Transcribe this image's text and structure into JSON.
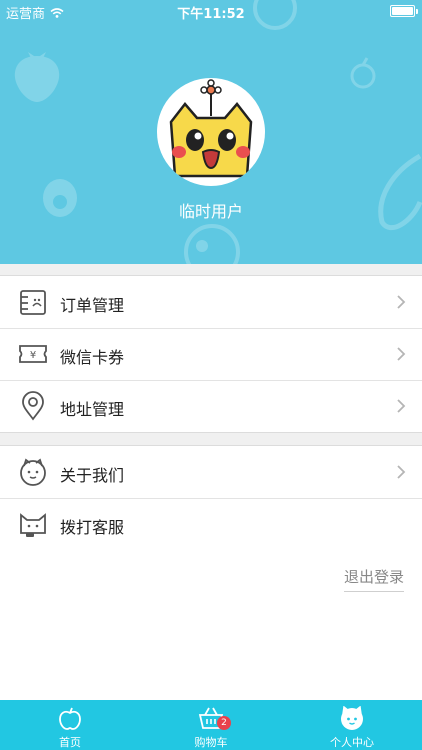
{
  "status_bar": {
    "carrier": "运营商",
    "time": "下午11:52"
  },
  "profile": {
    "username": "临时用户"
  },
  "menu_group_1": [
    {
      "label": "订单管理",
      "icon": "order-icon"
    },
    {
      "label": "微信卡券",
      "icon": "coupon-icon"
    },
    {
      "label": "地址管理",
      "icon": "location-pin-icon"
    }
  ],
  "menu_group_2": [
    {
      "label": "关于我们",
      "icon": "cat-face-icon"
    },
    {
      "label": "拨打客服",
      "icon": "cat-headset-icon"
    }
  ],
  "logout_label": "退出登录",
  "tabbar": {
    "tabs": [
      {
        "label": "首页",
        "icon": "apple-icon"
      },
      {
        "label": "购物车",
        "icon": "basket-icon",
        "badge": "2"
      },
      {
        "label": "个人中心",
        "icon": "cat-avatar-icon"
      }
    ]
  },
  "colors": {
    "header_bg": "#5ec8e2",
    "tabbar_bg": "#22c7e2",
    "badge": "#e8424c"
  }
}
